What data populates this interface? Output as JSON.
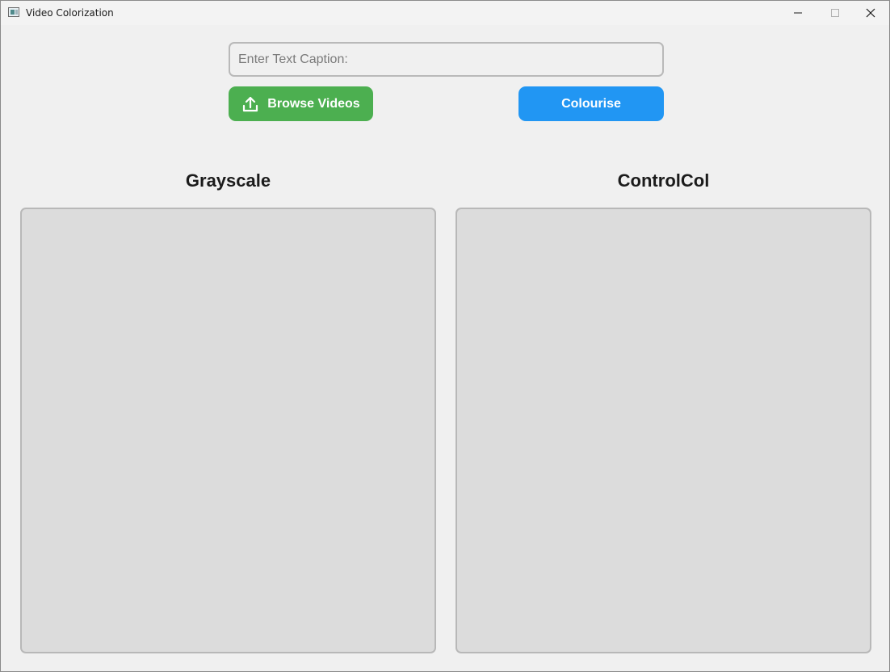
{
  "window": {
    "title": "Video Colorization",
    "icons": {
      "app": "app-window-icon",
      "minimize": "minimize-icon",
      "maximize": "maximize-icon",
      "close": "close-icon"
    }
  },
  "caption": {
    "value": "",
    "placeholder": "Enter Text Caption:"
  },
  "toolbar": {
    "browse_label": "Browse Videos",
    "browse_icon": "upload-icon",
    "colourise_label": "Colourise"
  },
  "panels": {
    "left_title": "Grayscale",
    "right_title": "ControlCol"
  },
  "colors": {
    "browse_button": "#4caf50",
    "colourise_button": "#2196f3",
    "panel_background": "#dcdcdc",
    "window_background": "#f0f0f0"
  }
}
